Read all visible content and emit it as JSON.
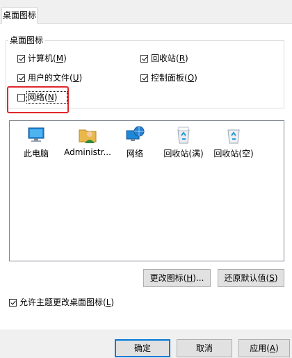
{
  "tab": {
    "label": "桌面图标"
  },
  "group": {
    "legend": "桌面图标"
  },
  "checkboxes": [
    {
      "label": "计算机",
      "key": "M",
      "checked": true
    },
    {
      "label": "回收站",
      "key": "R",
      "checked": true
    },
    {
      "label": "用户的文件",
      "key": "U",
      "checked": true
    },
    {
      "label": "控制面板",
      "key": "O",
      "checked": true
    },
    {
      "label": "网络",
      "key": "N",
      "checked": false
    }
  ],
  "icons": [
    {
      "label": "此电脑",
      "icon": "computer-icon"
    },
    {
      "label": "Administr...",
      "icon": "user-folder-icon"
    },
    {
      "label": "网络",
      "icon": "network-icon"
    },
    {
      "label": "回收站(满)",
      "icon": "recycle-bin-full-icon"
    },
    {
      "label": "回收站(空)",
      "icon": "recycle-bin-empty-icon"
    }
  ],
  "buttons": {
    "change_icon": "更改图标(",
    "change_icon_key": "H",
    "change_icon_tail": ")...",
    "restore_default": "还原默认值(",
    "restore_default_key": "S",
    "restore_default_tail": ")",
    "ok": "确定",
    "cancel": "取消",
    "apply": "应用(",
    "apply_key": "A",
    "apply_tail": ")"
  },
  "allow_themes": {
    "label": "允许主题更改桌面图标(",
    "key": "L",
    "tail": ")",
    "checked": true
  },
  "colors": {
    "highlight": "#e0262a",
    "accent": "#0078d7"
  }
}
